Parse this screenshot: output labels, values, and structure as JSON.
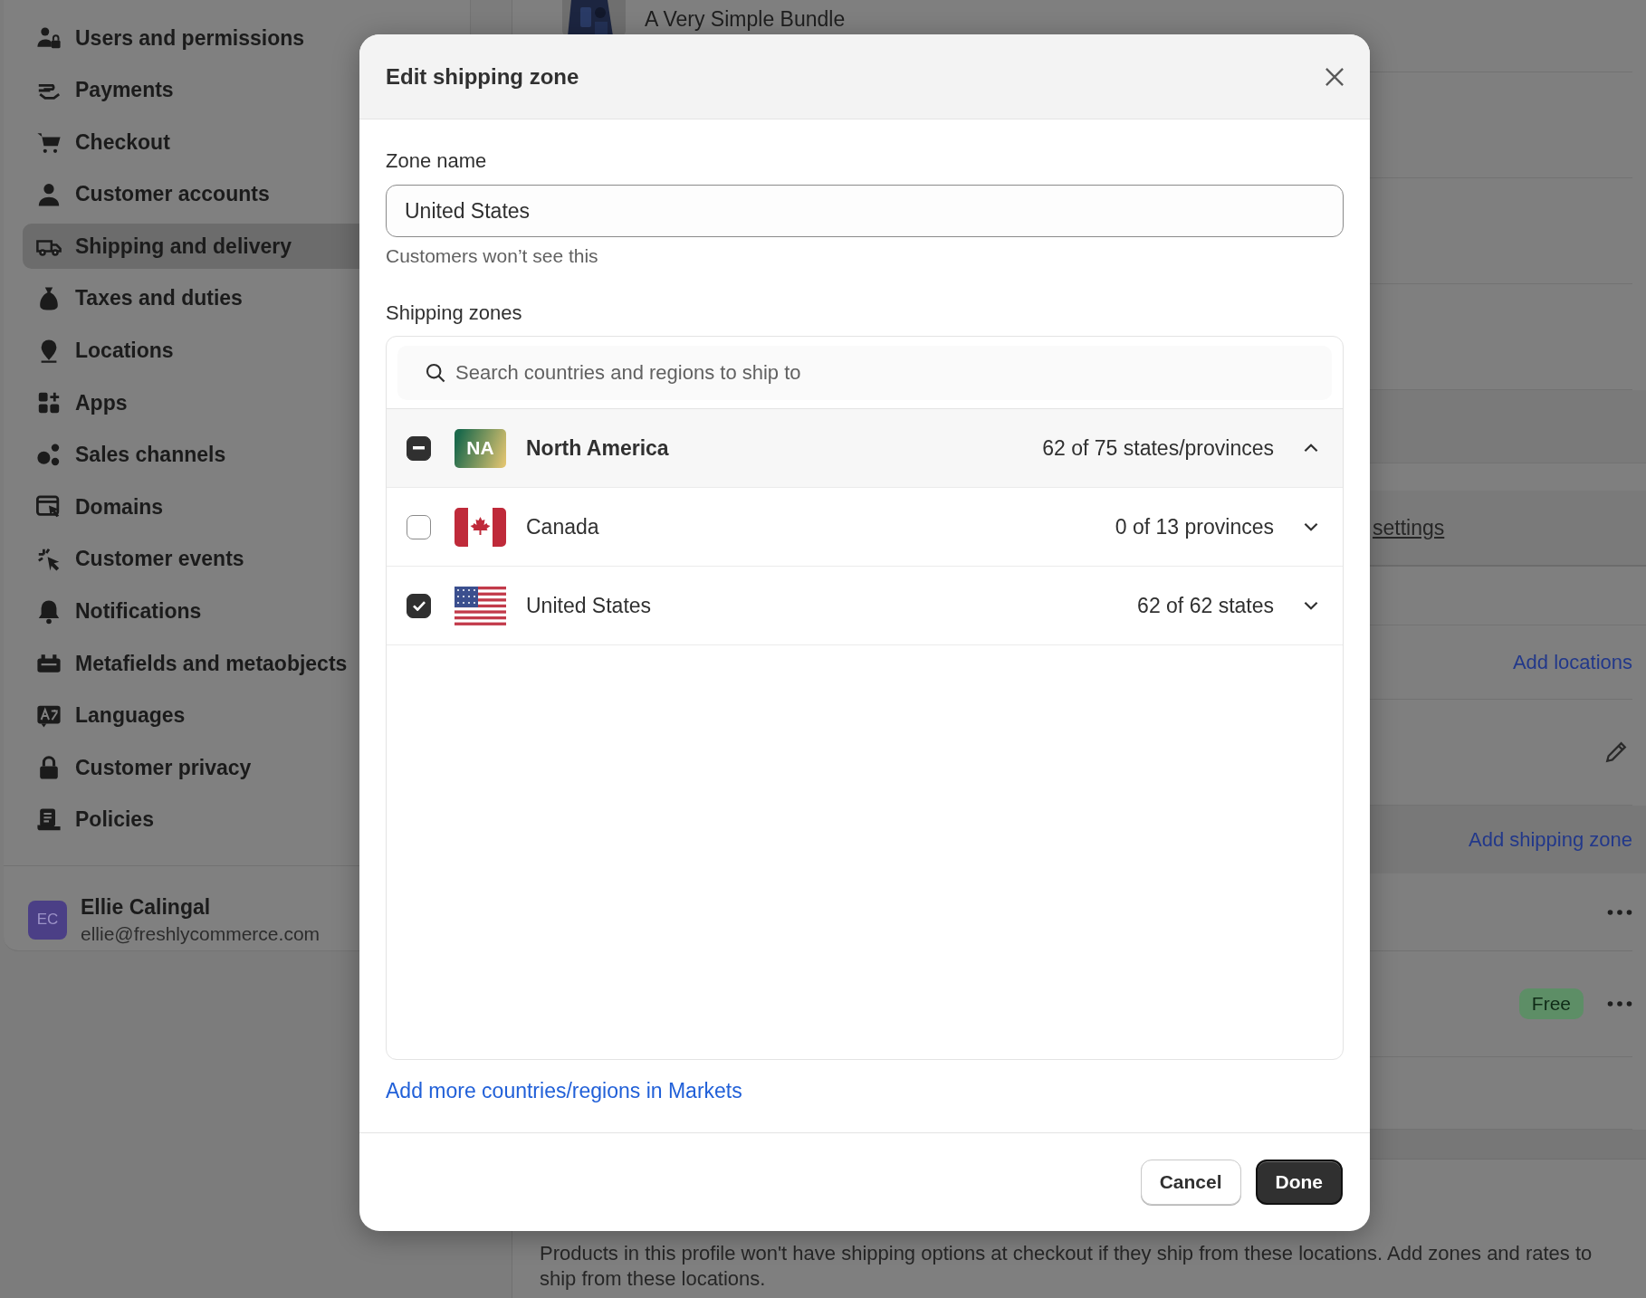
{
  "sidebar": {
    "items": [
      {
        "label": "Users and permissions",
        "selected": false
      },
      {
        "label": "Payments",
        "selected": false
      },
      {
        "label": "Checkout",
        "selected": false
      },
      {
        "label": "Customer accounts",
        "selected": false
      },
      {
        "label": "Shipping and delivery",
        "selected": true
      },
      {
        "label": "Taxes and duties",
        "selected": false
      },
      {
        "label": "Locations",
        "selected": false
      },
      {
        "label": "Apps",
        "selected": false
      },
      {
        "label": "Sales channels",
        "selected": false
      },
      {
        "label": "Domains",
        "selected": false
      },
      {
        "label": "Customer events",
        "selected": false
      },
      {
        "label": "Notifications",
        "selected": false
      },
      {
        "label": "Metafields and metaobjects",
        "selected": false
      },
      {
        "label": "Languages",
        "selected": false
      },
      {
        "label": "Customer privacy",
        "selected": false
      },
      {
        "label": "Policies",
        "selected": false
      }
    ],
    "user": {
      "initials": "EC",
      "name": "Ellie Calingal",
      "email": "ellie@freshlycommerce.com"
    }
  },
  "background": {
    "product": {
      "title": "A Very Simple Bundle"
    },
    "settings_link": "settings",
    "add_locations": "Add locations",
    "add_shipping_zone": "Add shipping zone",
    "rate_badge": "Free",
    "description": "Products in this profile won't have shipping options at checkout if they ship from these locations. Add zones and rates to ship from these locations."
  },
  "modal": {
    "title": "Edit shipping zone",
    "zone_name": {
      "label": "Zone name",
      "value": "United States",
      "help": "Customers won’t see this"
    },
    "shipping_zones": {
      "label": "Shipping zones",
      "search": {
        "placeholder": "Search countries and regions to ship to"
      },
      "regions": [
        {
          "kind": "region",
          "badge": "NA",
          "name": "North America",
          "count": "62 of 75 states/provinces",
          "checked": true,
          "indeterminate": true,
          "expanded": true
        },
        {
          "kind": "canada",
          "name": "Canada",
          "count": "0 of 13 provinces",
          "checked": false,
          "indeterminate": false,
          "expanded": false
        },
        {
          "kind": "usa",
          "name": "United States",
          "count": "62 of 62 states",
          "checked": true,
          "indeterminate": false,
          "expanded": false
        }
      ]
    },
    "markets_link": "Add more countries/regions in Markets",
    "buttons": [
      {
        "label": "Cancel",
        "kind": "secondary"
      },
      {
        "label": "Done",
        "kind": "primary"
      }
    ]
  }
}
